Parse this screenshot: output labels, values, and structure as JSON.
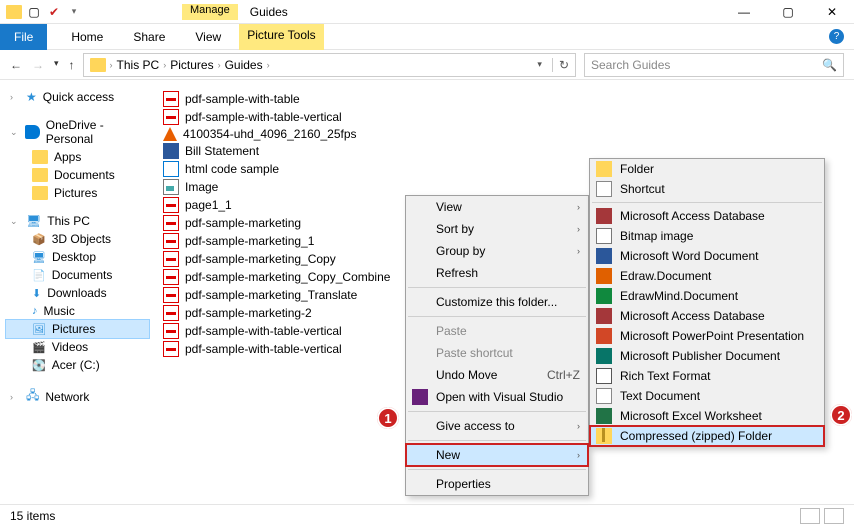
{
  "titlebar": {
    "manage_label": "Manage",
    "window_title": "Guides"
  },
  "ribbon": {
    "file": "File",
    "tabs": [
      "Home",
      "Share",
      "View"
    ],
    "picture_tools": "Picture Tools"
  },
  "navbar": {
    "breadcrumb": [
      "This PC",
      "Pictures",
      "Guides"
    ],
    "search_placeholder": "Search Guides"
  },
  "nav_pane": {
    "quick_access": {
      "label": "Quick access"
    },
    "onedrive": {
      "label": "OneDrive - Personal",
      "children": [
        "Apps",
        "Documents",
        "Pictures"
      ]
    },
    "this_pc": {
      "label": "This PC",
      "children": [
        "3D Objects",
        "Desktop",
        "Documents",
        "Downloads",
        "Music",
        "Pictures",
        "Videos",
        "Acer (C:)"
      ],
      "selected_index": 5
    },
    "network": {
      "label": "Network"
    }
  },
  "files": [
    {
      "icon": "pdf",
      "name": "pdf-sample-with-table"
    },
    {
      "icon": "pdf",
      "name": "pdf-sample-with-table-vertical"
    },
    {
      "icon": "vlc",
      "name": "4100354-uhd_4096_2160_25fps"
    },
    {
      "icon": "word",
      "name": "Bill Statement"
    },
    {
      "icon": "html",
      "name": "html code sample"
    },
    {
      "icon": "image",
      "name": "Image"
    },
    {
      "icon": "pdf",
      "name": "page1_1"
    },
    {
      "icon": "pdf",
      "name": "pdf-sample-marketing"
    },
    {
      "icon": "pdf",
      "name": "pdf-sample-marketing_1"
    },
    {
      "icon": "pdf",
      "name": "pdf-sample-marketing_Copy"
    },
    {
      "icon": "pdf",
      "name": "pdf-sample-marketing_Copy_Combine"
    },
    {
      "icon": "pdf",
      "name": "pdf-sample-marketing_Translate"
    },
    {
      "icon": "pdf",
      "name": "pdf-sample-marketing-2"
    },
    {
      "icon": "pdf",
      "name": "pdf-sample-with-table-vertical"
    },
    {
      "icon": "pdf",
      "name": "pdf-sample-with-table-vertical"
    }
  ],
  "context_menu": {
    "view": "View",
    "sort_by": "Sort by",
    "group_by": "Group by",
    "refresh": "Refresh",
    "customize": "Customize this folder...",
    "paste": "Paste",
    "paste_shortcut": "Paste shortcut",
    "undo_move": "Undo Move",
    "undo_shortcut": "Ctrl+Z",
    "open_vs": "Open with Visual Studio",
    "give_access": "Give access to",
    "new": "New",
    "properties": "Properties"
  },
  "new_submenu": [
    {
      "icon": "ic-folder",
      "label": "Folder"
    },
    {
      "icon": "ic-shortcut",
      "label": "Shortcut"
    },
    {
      "sep": true
    },
    {
      "icon": "ic-access",
      "label": "Microsoft Access Database"
    },
    {
      "icon": "ic-bmp",
      "label": "Bitmap image"
    },
    {
      "icon": "ic-word",
      "label": "Microsoft Word Document"
    },
    {
      "icon": "ic-edraw",
      "label": "Edraw.Document"
    },
    {
      "icon": "ic-emind",
      "label": "EdrawMind.Document"
    },
    {
      "icon": "ic-access",
      "label": "Microsoft Access Database"
    },
    {
      "icon": "ic-ppt",
      "label": "Microsoft PowerPoint Presentation"
    },
    {
      "icon": "ic-pub",
      "label": "Microsoft Publisher Document"
    },
    {
      "icon": "ic-rtf",
      "label": "Rich Text Format"
    },
    {
      "icon": "ic-txt",
      "label": "Text Document"
    },
    {
      "icon": "ic-xls",
      "label": "Microsoft Excel Worksheet"
    },
    {
      "icon": "ic-zip",
      "label": "Compressed (zipped) Folder",
      "highlight": true
    }
  ],
  "status": {
    "items_count": "15 items"
  },
  "markers": {
    "one": "1",
    "two": "2"
  }
}
